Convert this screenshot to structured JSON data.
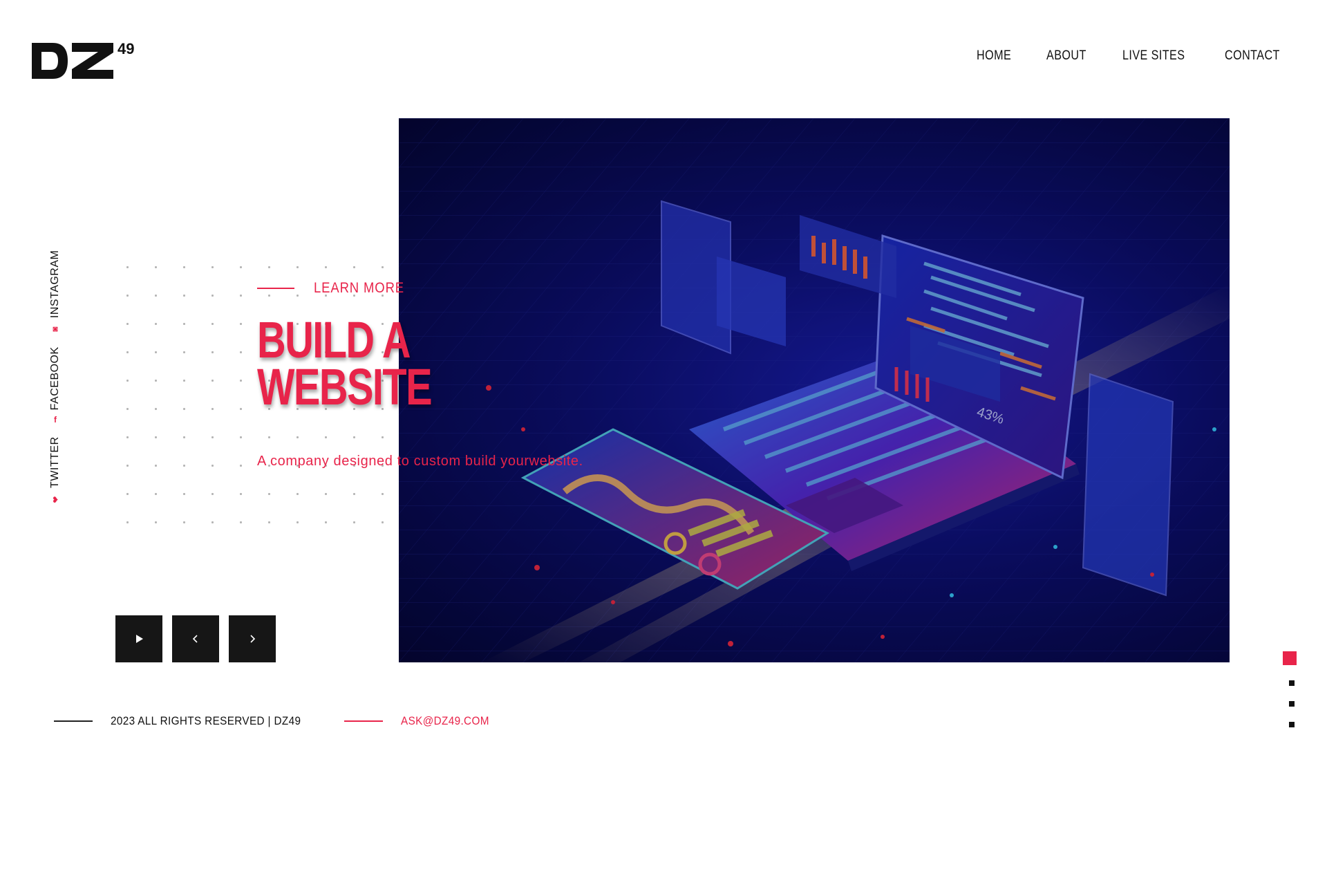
{
  "brand": {
    "logo_main": "DZ",
    "logo_super": "49"
  },
  "nav": {
    "items": [
      {
        "label": "HOME"
      },
      {
        "label": "ABOUT"
      },
      {
        "label": "LIVE SITES"
      },
      {
        "label": "CONTACT"
      }
    ]
  },
  "social": {
    "items": [
      {
        "label": "TWITTER",
        "icon": "twitter-icon"
      },
      {
        "label": "FACEBOOK",
        "icon": "facebook-icon"
      },
      {
        "label": "INSTAGRAM",
        "icon": "instagram-icon"
      }
    ]
  },
  "hero": {
    "eyebrow": "LEARN MORE",
    "headline_line1": "BUILD A",
    "headline_line2": "WEBSITE",
    "subtitle": "A company designed to custom build yourwebsite.",
    "image_label": "43%"
  },
  "controls": {
    "play": "play-icon",
    "prev": "chevron-left-icon",
    "next": "chevron-right-icon"
  },
  "footer": {
    "copyright": "2023 ALL RIGHTS RESERVED | DZ49",
    "email": "ASK@DZ49.COM"
  },
  "pagination": {
    "count": 4,
    "active_index": 0
  },
  "colors": {
    "accent": "#e8244a",
    "text": "#111111",
    "control_bg": "#161616",
    "hero_bg": "#0c0f6e"
  }
}
